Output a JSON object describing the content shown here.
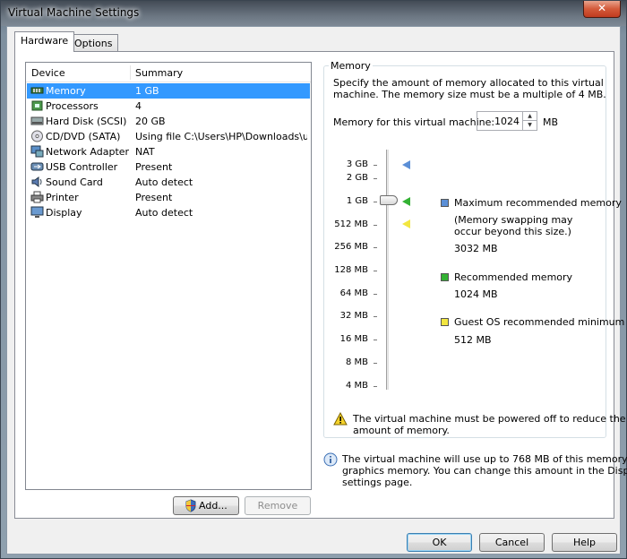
{
  "window": {
    "title": "Virtual Machine Settings",
    "close_label": "✕"
  },
  "tabs": [
    {
      "label": "Hardware"
    },
    {
      "label": "Options"
    }
  ],
  "device_list": {
    "columns": {
      "device": "Device",
      "summary": "Summary"
    },
    "rows": [
      {
        "device": "Memory",
        "summary": "1 GB"
      },
      {
        "device": "Processors",
        "summary": "4"
      },
      {
        "device": "Hard Disk (SCSI)",
        "summary": "20 GB"
      },
      {
        "device": "CD/DVD (SATA)",
        "summary": "Using file C:\\Users\\HP\\Downloads\\ub..."
      },
      {
        "device": "Network Adapter",
        "summary": "NAT"
      },
      {
        "device": "USB Controller",
        "summary": "Present"
      },
      {
        "device": "Sound Card",
        "summary": "Auto detect"
      },
      {
        "device": "Printer",
        "summary": "Present"
      },
      {
        "device": "Display",
        "summary": "Auto detect"
      }
    ],
    "selected_index": 0
  },
  "list_buttons": {
    "add": "Add...",
    "remove": "Remove"
  },
  "memory": {
    "group_label": "Memory",
    "description_line1": "Specify the amount of memory allocated to this virtual",
    "description_line2": "machine. The memory size must be a multiple of 4 MB.",
    "field_label": "Memory for this virtual machine:",
    "value": "1024",
    "unit": "MB",
    "scale": [
      "3 GB",
      "2 GB",
      "1 GB",
      "512 MB",
      "256 MB",
      "128 MB",
      "64 MB",
      "32 MB",
      "16 MB",
      "8 MB",
      "4 MB"
    ],
    "legend": {
      "max_title": "Maximum recommended memory",
      "max_note1": "(Memory swapping may",
      "max_note2": "occur beyond this size.)",
      "max_value": "3032 MB",
      "rec_title": "Recommended memory",
      "rec_value": "1024 MB",
      "min_title": "Guest OS recommended minimum",
      "min_value": "512 MB"
    },
    "warning_line1": "The virtual machine must be powered off to reduce the",
    "warning_line2": "amount of memory.",
    "info_line1": "The virtual machine will use up to 768 MB of this memory for",
    "info_line2": "graphics memory. You can change this amount in the Display",
    "info_line3": "settings page."
  },
  "colors": {
    "max": "#5b8fd6",
    "rec": "#33b233",
    "min": "#f2e640",
    "selection": "#3399ff"
  },
  "dialog_buttons": {
    "ok": "OK",
    "cancel": "Cancel",
    "help": "Help"
  }
}
